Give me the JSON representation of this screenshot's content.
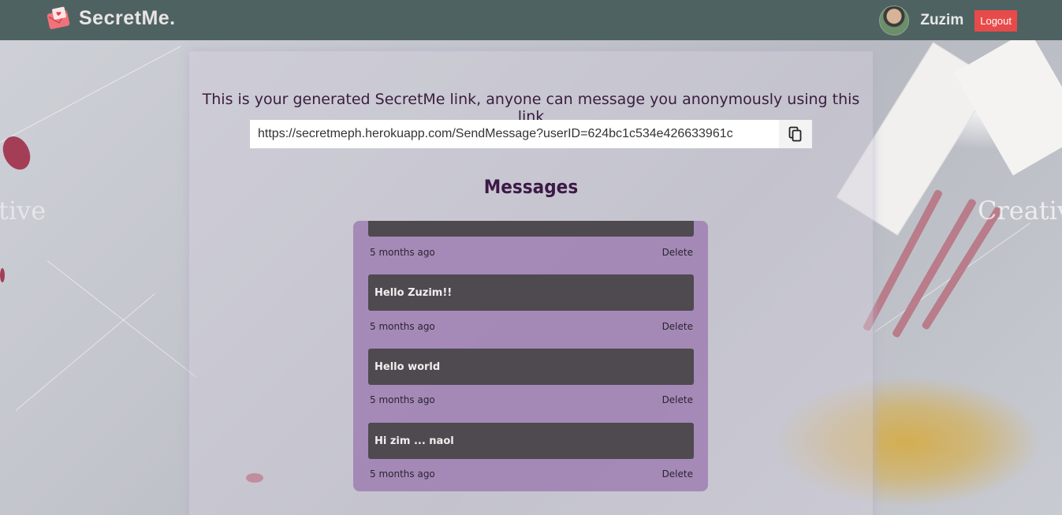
{
  "navbar": {
    "brand": "SecretMe.",
    "username": "Zuzim",
    "logout_label": "Logout"
  },
  "main": {
    "link_caption": "This is your generated SecretMe link, anyone can message you anonymously using this link",
    "link_value": "https://secretmeph.herokuapp.com/SendMessage?userID=624bc1c534e426633961c",
    "messages_title": "Messages"
  },
  "messages": [
    {
      "text": "",
      "time": "5 months ago",
      "delete_label": "Delete"
    },
    {
      "text": "Hello Zuzim!!",
      "time": "5 months ago",
      "delete_label": "Delete"
    },
    {
      "text": "Hello world",
      "time": "5 months ago",
      "delete_label": "Delete"
    },
    {
      "text": "Hi zim ... naol",
      "time": "5 months ago",
      "delete_label": "Delete"
    }
  ],
  "icons": {
    "brand": "envelope-heart-icon",
    "copy": "copy-icon",
    "avatar": "user-avatar"
  },
  "colors": {
    "navbar": "#4f6262",
    "logout": "#e84a4a",
    "messages_box": "#9b78af",
    "message_card": "#4f4a50",
    "title": "#3d1946"
  }
}
